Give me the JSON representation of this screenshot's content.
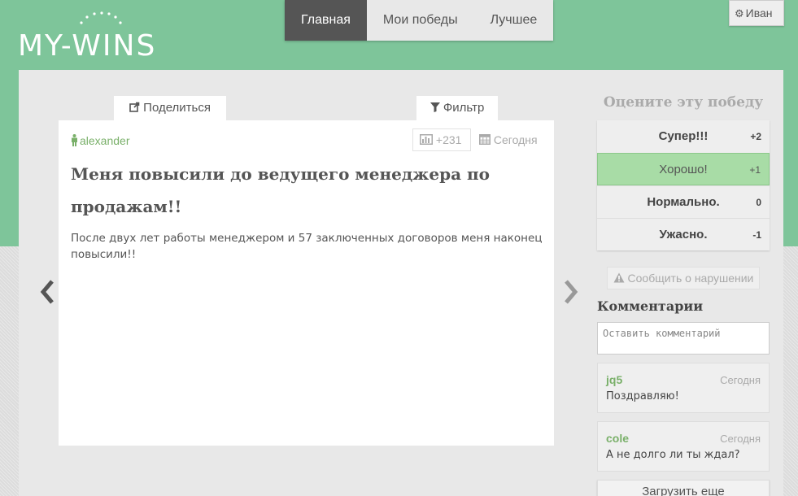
{
  "brand": {
    "logo_text": "MY-WINS",
    "color": "#7ec59a"
  },
  "nav": {
    "items": [
      {
        "label": "Главная",
        "active": true
      },
      {
        "label": "Мои победы",
        "active": false
      },
      {
        "label": "Лучшее",
        "active": false
      }
    ]
  },
  "user": {
    "icon": "gear-icon",
    "name": "Иван"
  },
  "toolbar": {
    "share_label": "Поделиться",
    "share_icon": "share-icon",
    "filter_label": "Фильтр",
    "filter_icon": "filter-icon"
  },
  "post": {
    "author": "alexander",
    "author_icon": "person-icon",
    "score": "+231",
    "score_icon": "bar-chart-icon",
    "date": "Сегодня",
    "date_icon": "calendar-icon",
    "title": "Меня повысили до ведущего менеджера по продажам!!",
    "body": "После двух лет работы менеджером и 57 заключенных договоров меня наконец повысили!!"
  },
  "rating": {
    "title": "Оцените эту победу",
    "options": [
      {
        "label": "Супер!!!",
        "points": "+2",
        "selected": false
      },
      {
        "label": "Хорошо!",
        "points": "+1",
        "selected": true
      },
      {
        "label": "Нормально.",
        "points": "0",
        "selected": false
      },
      {
        "label": "Ужасно.",
        "points": "-1",
        "selected": false
      }
    ],
    "selected_color": "#a8dca6"
  },
  "report": {
    "label": "Сообщить о нарушении",
    "icon": "warning-icon"
  },
  "comments": {
    "title": "Комментарии",
    "input_placeholder": "Оставить комментарий",
    "items": [
      {
        "user": "jq5",
        "date": "Сегодня",
        "text": "Поздравляю!"
      },
      {
        "user": "cole",
        "date": "Сегодня",
        "text": "А не долго ли ты ждал?"
      }
    ],
    "load_more_label": "Загрузить еще"
  }
}
